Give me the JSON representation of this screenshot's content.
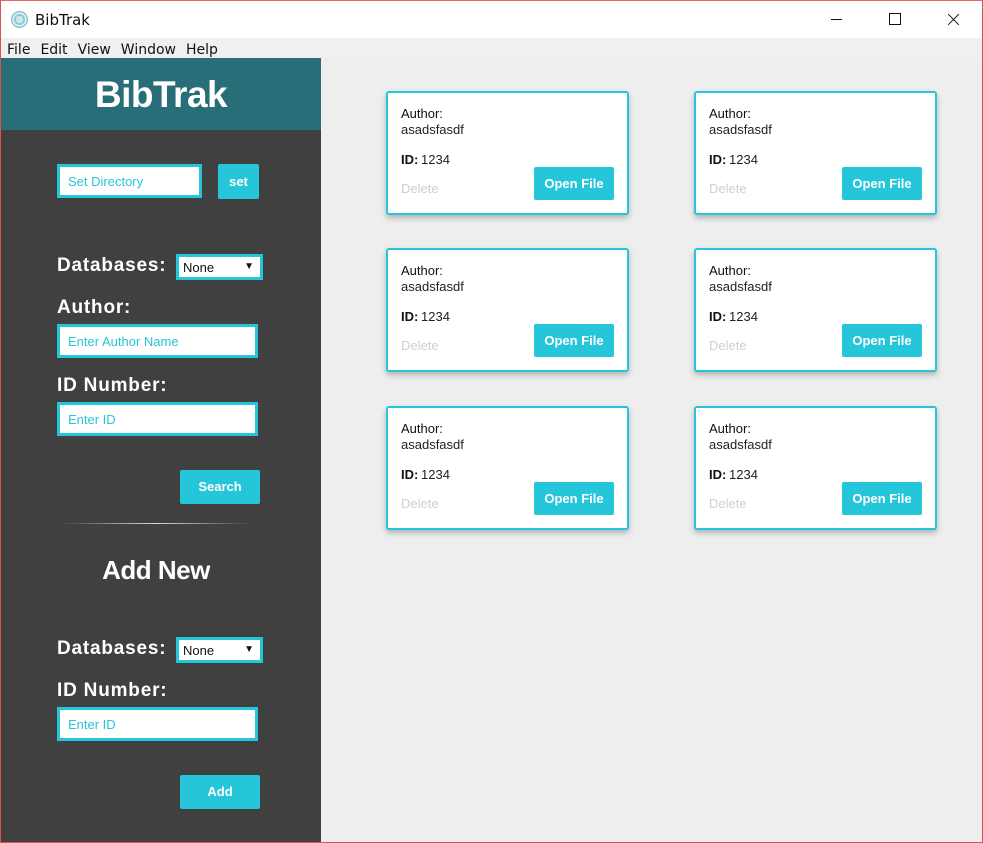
{
  "window": {
    "title": "BibTrak"
  },
  "menu": [
    "File",
    "Edit",
    "View",
    "Window",
    "Help"
  ],
  "sidebar": {
    "brand": "BibTrak",
    "directory_placeholder": "Set Directory",
    "set_button": "set",
    "search": {
      "databases_label": "Databases:",
      "databases_value": "None",
      "author_label": "Author:",
      "author_placeholder": "Enter Author Name",
      "id_label": "ID Number:",
      "id_placeholder": "Enter ID",
      "search_button": "Search"
    },
    "add_new": {
      "heading": "Add New",
      "databases_label": "Databases:",
      "databases_value": "None",
      "id_label": "ID Number:",
      "id_placeholder": "Enter ID",
      "add_button": "Add"
    }
  },
  "cards": [
    {
      "author_label": "Author:",
      "author": "asadsfasdf",
      "id_label": "ID:",
      "id": "1234",
      "delete_label": "Delete",
      "open_label": "Open File"
    },
    {
      "author_label": "Author:",
      "author": "asadsfasdf",
      "id_label": "ID:",
      "id": "1234",
      "delete_label": "Delete",
      "open_label": "Open File"
    },
    {
      "author_label": "Author:",
      "author": "asadsfasdf",
      "id_label": "ID:",
      "id": "1234",
      "delete_label": "Delete",
      "open_label": "Open File"
    },
    {
      "author_label": "Author:",
      "author": "asadsfasdf",
      "id_label": "ID:",
      "id": "1234",
      "delete_label": "Delete",
      "open_label": "Open File"
    },
    {
      "author_label": "Author:",
      "author": "asadsfasdf",
      "id_label": "ID:",
      "id": "1234",
      "delete_label": "Delete",
      "open_label": "Open File"
    },
    {
      "author_label": "Author:",
      "author": "asadsfasdf",
      "id_label": "ID:",
      "id": "1234",
      "delete_label": "Delete",
      "open_label": "Open File"
    }
  ],
  "colors": {
    "accent": "#26c6da",
    "brand_bar": "#286e78",
    "sidebar": "#404040",
    "main_bg": "#eeeeee",
    "delete_text": "#cfcfcf"
  }
}
